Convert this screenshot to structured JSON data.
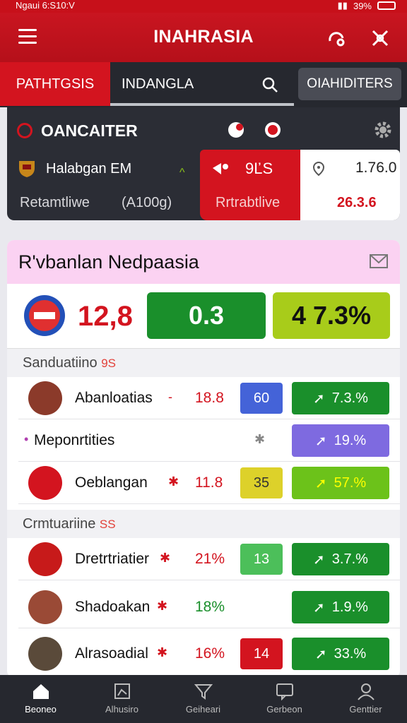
{
  "status": {
    "time": "Ngaui 6:S10:V",
    "battery": "39%"
  },
  "app": {
    "title": "INAHRASIA"
  },
  "tabs": {
    "tab1": "PATHTGSIS",
    "tab2": "INDANGLA",
    "tab3": "OIAHIDITERS"
  },
  "panel": {
    "title": "OANCAITER",
    "row1_label": "Halabgan EM",
    "row2_label": "Retamtliwe",
    "row2_value": "(A100g)",
    "red_score": "9ĽS",
    "red_label": "Rrtrabtlive",
    "white_value": "1.76.0",
    "white_pct": "26.3.6"
  },
  "card": {
    "title": "R'vbanlan Nedpaasia",
    "summary_pct": "12,8",
    "summary_pill1": "0.3",
    "summary_pill2": "4 7.3%",
    "section1": "Sanduatiino",
    "section1_badge": "9S",
    "section2": "Crmtuariine",
    "section2_badge": "SS",
    "rows": [
      {
        "name": "Abanloatias",
        "pct": "18.8",
        "small": "60",
        "green": "7.3.%"
      },
      {
        "name": "Meponrtities",
        "pct": "",
        "small": "",
        "green": "19.%"
      },
      {
        "name": "Oeblangan",
        "pct": "11.8",
        "small": "35",
        "green": "57.%"
      },
      {
        "name": "Dretrtriatier",
        "pct": "21%",
        "small": "13",
        "green": "3.7.%"
      },
      {
        "name": "Shadoakan",
        "pct": "18%",
        "small": "",
        "green": "1.9.%"
      },
      {
        "name": "Alrasoadial",
        "pct": "16%",
        "small": "14",
        "green": "33.%"
      }
    ]
  },
  "nav": [
    "Beoneo",
    "Alhusiro",
    "Geiheari",
    "Gerbeon",
    "Genttier"
  ],
  "colors": {
    "brand_red": "#d3141f",
    "dark": "#26282f",
    "green": "#1a8f2b",
    "lime": "#8cc21a",
    "blue": "#4463d8",
    "purple": "#8a6be0",
    "yellow": "#dfd22a"
  }
}
